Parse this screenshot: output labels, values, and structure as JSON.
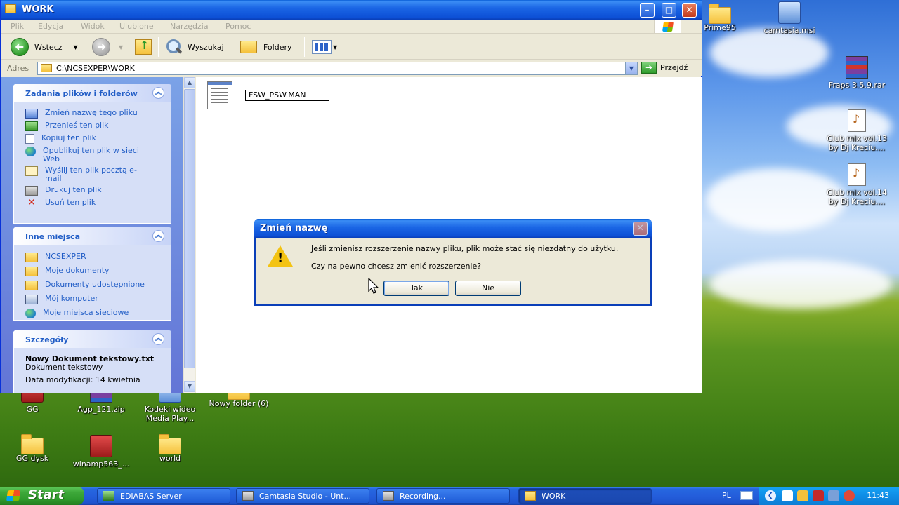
{
  "window": {
    "title": "WORK"
  },
  "menu": [
    "Plik",
    "Edycja",
    "Widok",
    "Ulubione",
    "Narzędzia",
    "Pomoc"
  ],
  "toolbar": {
    "back": "Wstecz",
    "search": "Wyszukaj",
    "folders": "Foldery"
  },
  "address": {
    "label": "Adres",
    "path": "C:\\NCSEXPER\\WORK",
    "go": "Przejdź"
  },
  "tasks": {
    "file_tasks": {
      "title": "Zadania plików i folderów",
      "items": [
        "Zmień nazwę tego pliku",
        "Przenieś ten plik",
        "Kopiuj ten plik",
        "Opublikuj ten plik w sieci Web",
        "Wyślij ten plik pocztą e-mail",
        "Drukuj ten plik",
        "Usuń ten plik"
      ]
    },
    "other_places": {
      "title": "Inne miejsca",
      "items": [
        "NCSEXPER",
        "Moje dokumenty",
        "Dokumenty udostępnione",
        "Mój komputer",
        "Moje miejsca sieciowe"
      ]
    },
    "details": {
      "title": "Szczegóły",
      "name": "Nowy Dokument tekstowy.txt",
      "type": "Dokument tekstowy",
      "modified": "Data modyfikacji: 14 kwietnia"
    }
  },
  "file": {
    "name_edit": "FSW_PSW.MAN"
  },
  "dialog": {
    "title": "Zmień nazwę",
    "message1": "Jeśli zmienisz rozszerzenie nazwy pliku, plik może stać się niezdatny do użytku.",
    "message2": "Czy na pewno chcesz zmienić rozszerzenie?",
    "yes": "Tak",
    "no": "Nie"
  },
  "desktop_icons": {
    "prime95": "Prime95",
    "camtasia": "camtasia.msi",
    "fraps": "Fraps 3.5.9.rar",
    "club13": "Club mix vol.13 by Dj Kreciu....",
    "club14": "Club mix vol.14 by Dj Kreciu....",
    "gg": "GG",
    "agp": "Agp_121.zip",
    "kodeki": "Kodeki wideo Media Play...",
    "newfolder": "Nowy folder (6)",
    "ggdysk": "GG dysk",
    "winamp": "winamp563_...",
    "world": "world"
  },
  "taskbar": {
    "start": "Start",
    "tasks": [
      "EDIABAS Server",
      "Camtasia Studio - Unt...",
      "Recording...",
      "WORK"
    ],
    "lang": "PL",
    "clock": "11:43"
  },
  "colors": {
    "xp_blue": "#0a5fd8",
    "task_pane": "#d6dff7",
    "start_green": "#3ea83a",
    "tray_blue": "#0f8de6"
  }
}
